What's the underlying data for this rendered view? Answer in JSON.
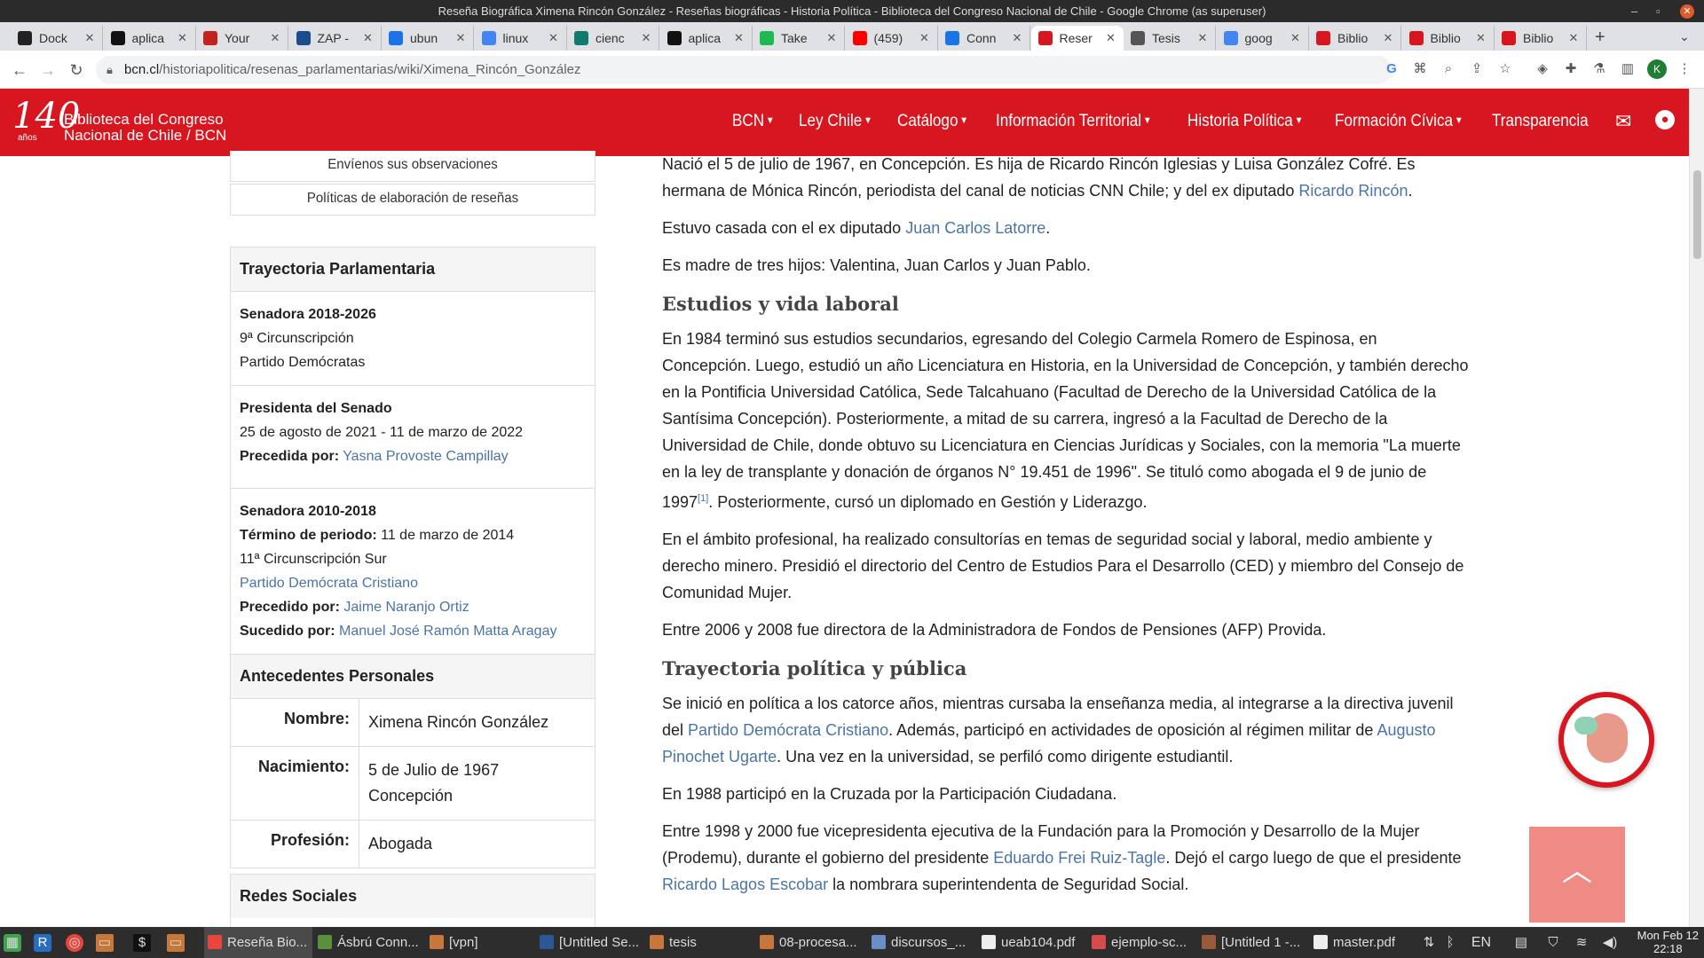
{
  "window_title": "Reseña Biográfica Ximena Rincón González - Reseñas biográficas - Historia Política - Biblioteca del Congreso Nacional de Chile - Google Chrome (as superuser)",
  "tabs": [
    {
      "label": "Dock",
      "color": "#222"
    },
    {
      "label": "aplica",
      "color": "#111"
    },
    {
      "label": "Your",
      "color": "#c5221f"
    },
    {
      "label": "ZAP -",
      "color": "#1a4d8f"
    },
    {
      "label": "ubun",
      "color": "#1a73e8"
    },
    {
      "label": "linux",
      "color": "#4285f4"
    },
    {
      "label": "cienc",
      "color": "#0f7b6c"
    },
    {
      "label": "aplica",
      "color": "#111"
    },
    {
      "label": "Take",
      "color": "#1db954"
    },
    {
      "label": "(459)",
      "color": "#ff0000"
    },
    {
      "label": "Conn",
      "color": "#1a73e8"
    },
    {
      "label": "Reser",
      "color": "#d8161f"
    },
    {
      "label": "Tesis",
      "color": "#555"
    },
    {
      "label": "goog",
      "color": "#4285f4"
    },
    {
      "label": "Biblio",
      "color": "#d8161f"
    },
    {
      "label": "Biblio",
      "color": "#d8161f"
    },
    {
      "label": "Biblio",
      "color": "#d8161f"
    }
  ],
  "address": {
    "domain": "bcn.cl",
    "path": "/historiapolitica/resenas_parlamentarias/wiki/Ximena_Rincón_González"
  },
  "profile_initial": "K",
  "logo": {
    "number": "140",
    "sub": "años",
    "line1": "Biblioteca del Congreso",
    "line2": "Nacional de Chile / BCN"
  },
  "menu": [
    "BCN",
    "Ley Chile",
    "Catálogo",
    "Información Territorial",
    "Historia Política",
    "Formación Cívica",
    "Transparencia"
  ],
  "sidebar": {
    "btn_observaciones": "Envíenos sus observaciones",
    "btn_politicas": "Políticas de elaboración de reseñas",
    "trayectoria_title": "Trayectoria Parlamentaria",
    "s1_title": "Senadora 2018-2026",
    "s1_l1": "9ª Circunscripción",
    "s1_l2": "Partido Demócratas",
    "s2_title": "Presidenta del Senado",
    "s2_l1": "25 de agosto de 2021 - 11 de marzo de 2022",
    "s2_prec_label": "Precedida por:",
    "s2_prec_val": "Yasna Provoste Campillay",
    "s3_title": "Senadora 2010-2018",
    "s3_term_label": "Término de periodo:",
    "s3_term_val": "11 de marzo de 2014",
    "s3_l1": "11ª Circunscripción Sur",
    "s3_party": "Partido Demócrata Cristiano",
    "s3_prec_label": "Precedido por:",
    "s3_prec_val": "Jaime Naranjo Ortiz",
    "s3_suc_label": "Sucedido por:",
    "s3_suc_val": "Manuel José Ramón Matta Aragay",
    "antecedentes_title": "Antecedentes Personales",
    "nombre_label": "Nombre:",
    "nombre_val": "Ximena Rincón González",
    "nac_label": "Nacimiento:",
    "nac_val1": "5 de Julio de 1967",
    "nac_val2": "Concepción",
    "prof_label": "Profesión:",
    "prof_val": "Abogada",
    "redes_title": "Redes Sociales"
  },
  "content": {
    "p1a": "Nació el 5 de julio de 1967, en Concepción. Es hija de Ricardo Rincón Iglesias y Luisa González Cofré. Es hermana de Mónica Rincón, periodista del canal de noticias CNN Chile; y del ex diputado ",
    "p1_link": "Ricardo Rincón",
    "p1b": ".",
    "p2a": "Estuvo casada con el ex diputado ",
    "p2_link": "Juan Carlos Latorre",
    "p2b": ".",
    "p3": "Es madre de tres hijos: Valentina, Juan Carlos y Juan Pablo.",
    "h_estudios": "Estudios y vida laboral",
    "p4a": "En 1984 terminó sus estudios secundarios, egresando del Colegio Carmela Romero de Espinosa, en Concepción. Luego, estudió un año Licenciatura en Historia, en la Universidad de Concepción, y también derecho en la Pontificia Universidad Católica, Sede Talcahuano (Facultad de Derecho de la Universidad Católica de la Santísima Concepción). Posteriormente, a mitad de su carrera, ingresó a la Facultad de Derecho de la Universidad de Chile, donde obtuvo su Licenciatura en Ciencias Jurídicas y Sociales, con la memoria \"La muerte en la ley de transplante y donación de órganos N° 19.451 de 1996\". Se tituló como abogada el 9 de junio de 1997",
    "p4_ref": "[1]",
    "p4b": ". Posteriormente, cursó un diplomado en Gestión y Liderazgo.",
    "p5": "En el ámbito profesional, ha realizado consultorías en temas de seguridad social y laboral, medio ambiente y derecho minero. Presidió el directorio del Centro de Estudios Para el Desarrollo (CED) y miembro del Consejo de Comunidad Mujer.",
    "p6": "Entre 2006 y 2008 fue directora de la Administradora de Fondos de Pensiones (AFP) Provida.",
    "h_trayectoria": "Trayectoria política y pública",
    "p7a": "Se inició en política a los catorce años, mientras cursaba la enseñanza media, al integrarse a la directiva juvenil del ",
    "p7_link1": "Partido Demócrata Cristiano",
    "p7b": ". Además, participó en actividades de oposición al régimen militar de ",
    "p7_link2": "Augusto Pinochet Ugarte",
    "p7c": ". Una vez en la universidad, se perfiló como dirigente estudiantil.",
    "p8": "En 1988 participó en la Cruzada por la Participación Ciudadana.",
    "p9a": "Entre 1998 y 2000 fue vicepresidenta ejecutiva de la Fundación para la Promoción y Desarrollo de la Mujer (Prodemu), durante el gobierno del presidente ",
    "p9_link1": "Eduardo Frei Ruiz-Tagle",
    "p9b": ". Dejó el cargo luego de que el presidente ",
    "p9_link2": "Ricardo Lagos Escobar",
    "p9c": " la nombrara superintendenta de Seguridad Social."
  },
  "taskbar": {
    "items": [
      "Reseña Bio...",
      "Ásbrú Conn...",
      "[vpn]",
      "[Untitled Se...",
      "tesis",
      "08-procesa...",
      "discursos_...",
      "ueab104.pdf",
      "ejemplo-sc...",
      "[Untitled 1 -...",
      "master.pdf"
    ],
    "lang": "EN",
    "clock_day": "Mon Feb 12",
    "clock_time": "22:18"
  }
}
